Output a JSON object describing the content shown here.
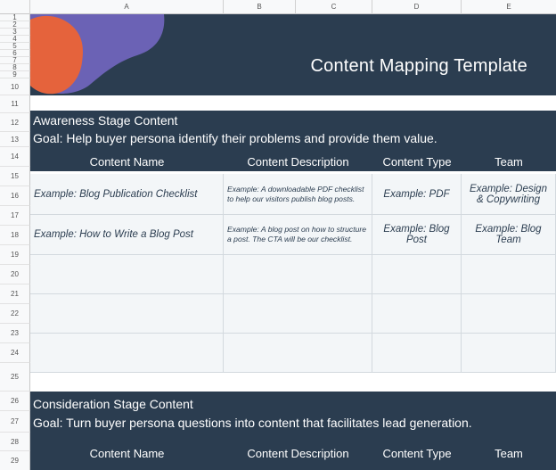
{
  "columns": [
    "",
    "A",
    "B",
    "C",
    "D",
    "E"
  ],
  "rows": [
    "1",
    "2",
    "3",
    "4",
    "5",
    "6",
    "7",
    "8",
    "9",
    "10",
    "11",
    "12",
    "13",
    "14",
    "15",
    "16",
    "17",
    "18",
    "19",
    "20",
    "21",
    "22",
    "23",
    "24",
    "25",
    "26",
    "27",
    "28",
    "29"
  ],
  "banner": {
    "title": "Content Mapping Template"
  },
  "awareness": {
    "title": "Awareness Stage Content",
    "goal": "Goal: Help buyer persona identify their problems and provide them value.",
    "headers": [
      "Content Name",
      "Content Description",
      "Content Type",
      "Team"
    ],
    "rows": [
      {
        "name": "Example: Blog Publication Checklist",
        "description": "Example: A downloadable PDF checklist to help our visitors publish blog posts.",
        "type": "Example: PDF",
        "team": "Example: Design & Copywriting"
      },
      {
        "name": "Example: How to Write a Blog Post",
        "description": "Example: A blog post on how to structure a post. The CTA will be our checklist.",
        "type": "Example: Blog Post",
        "team": "Example: Blog Team"
      }
    ]
  },
  "consideration": {
    "title": "Consideration Stage Content",
    "goal": "Goal: Turn buyer persona questions into content that facilitates lead generation.",
    "headers": [
      "Content Name",
      "Content Description",
      "Content Type",
      "Team"
    ]
  },
  "colors": {
    "dark": "#2b3d50",
    "accent_orange": "#e5633c",
    "accent_purple": "#6b62b5",
    "cell_bg": "#f3f6f8"
  }
}
